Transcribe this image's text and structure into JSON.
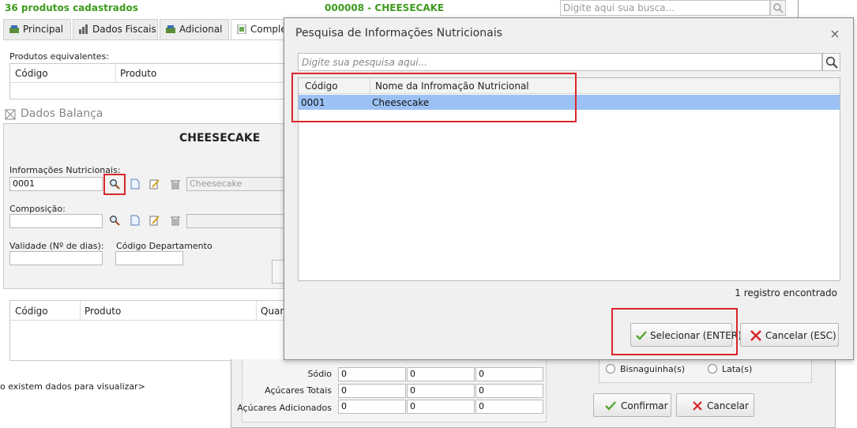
{
  "topbar": {
    "count_label": "36 produtos cadastrados",
    "product_title": "000008 - CHEESECAKE",
    "search_placeholder": "Digite aqui sua busca..."
  },
  "tabs": [
    {
      "label": "Principal"
    },
    {
      "label": "Dados Fiscais"
    },
    {
      "label": "Adicional"
    },
    {
      "label": "Comple"
    }
  ],
  "equivalents": {
    "label": "Produtos equivalentes:",
    "col_code": "Código",
    "col_product": "Produto"
  },
  "scale_section": {
    "title": "Dados Balança",
    "product_name": "CHEESECAKE",
    "nutri_label": "Informações Nutricionais:",
    "nutri_code": "0001",
    "nutri_name": "Cheesecake",
    "composition_label": "Composição:",
    "validity_label": "Validade (Nº de dias):",
    "dept_label": "Código Departamento"
  },
  "lower_table": {
    "col_code": "Código",
    "col_product": "Produto",
    "col_qty": "Quan",
    "empty_text": "o existem dados para visualizar>"
  },
  "nutrient_rows": [
    {
      "label": "Sódio",
      "values": [
        "0",
        "0",
        "0"
      ]
    },
    {
      "label": "Açúcares Totais",
      "values": [
        "0",
        "0",
        "0"
      ]
    },
    {
      "label": "Açúcares Adicionados",
      "values": [
        "0",
        "0",
        "0"
      ]
    }
  ],
  "packaging": {
    "option1": "Bisnaguinha(s)",
    "option2": "Lata(s)"
  },
  "back_buttons": {
    "confirm": "Confirmar",
    "cancel": "Cancelar"
  },
  "dialog": {
    "title": "Pesquisa de Informações Nutricionais",
    "search_placeholder": "Digite sua pesquisa aqui...",
    "col_code": "Código",
    "col_name": "Nome da Infromação Nutricional",
    "rows": [
      {
        "code": "0001",
        "name": "Cheesecake"
      }
    ],
    "record_count": "1 registro encontrado",
    "select_button": "Selecionar (ENTER)",
    "cancel_button": "Cancelar (ESC)"
  },
  "colors": {
    "accent_green": "#3d9b1d",
    "selection_blue": "#9cc2f5",
    "highlight_red": "#d9262b"
  }
}
